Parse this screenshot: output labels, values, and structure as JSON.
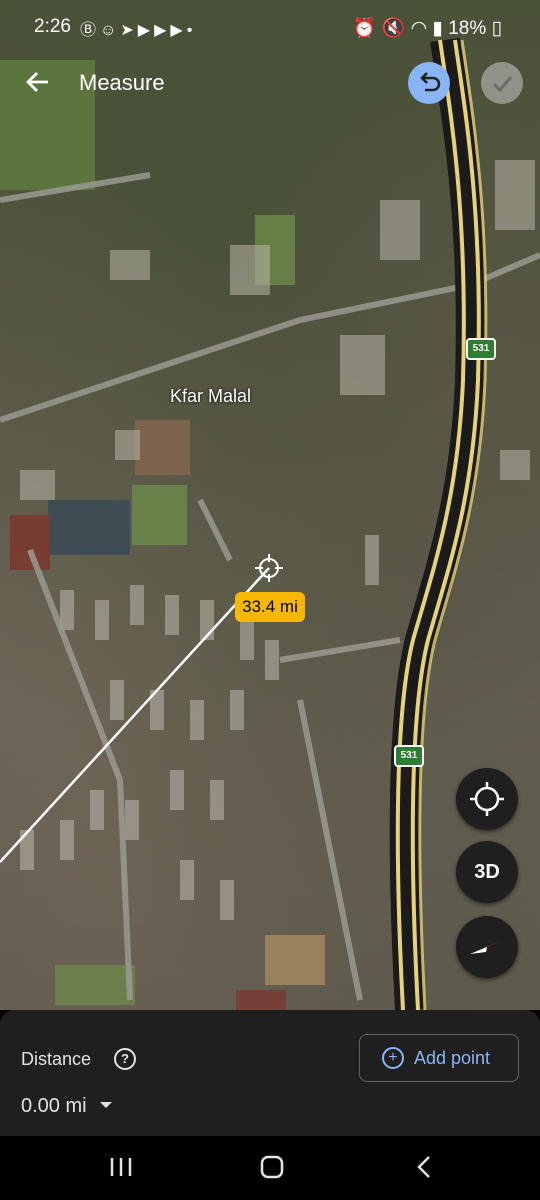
{
  "status_bar": {
    "time": "2:26",
    "left_icons": [
      "b-circle-icon",
      "snapchat-icon",
      "telegram-icon",
      "youtube-icon",
      "youtube-icon",
      "youtube-icon",
      "dot-icon"
    ],
    "right_icons": [
      "alarm-icon",
      "mute-icon",
      "wifi-icon",
      "signal-icon",
      "battery-icon"
    ],
    "battery": "18%"
  },
  "header": {
    "title": "Measure"
  },
  "map": {
    "place_label": "Kfar Malal",
    "route_shields": [
      "531",
      "531"
    ],
    "distance_chip": "33.4 mi"
  },
  "fabs": {
    "three_d_label": "3D"
  },
  "bottom_sheet": {
    "distance_label": "Distance",
    "distance_value": "0.00 mi",
    "add_point_label": "Add point"
  },
  "colors": {
    "accent": "#8ab4f8",
    "chip": "#f6b800",
    "sheet_bg": "#1f1f1f",
    "highway": "#e7d27a"
  }
}
